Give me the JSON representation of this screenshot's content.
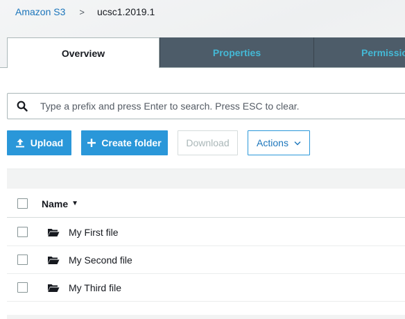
{
  "breadcrumb": {
    "root": "Amazon S3",
    "separator": ">",
    "current": "ucsc1.2019.1"
  },
  "tabs": [
    {
      "label": "Overview",
      "active": true
    },
    {
      "label": "Properties",
      "active": false
    },
    {
      "label": "Permissio",
      "active": false
    }
  ],
  "search": {
    "placeholder": "Type a prefix and press Enter to search. Press ESC to clear.",
    "value": ""
  },
  "actions": {
    "upload": "Upload",
    "create_folder": "Create folder",
    "download": "Download",
    "actions": "Actions"
  },
  "table": {
    "name_header": "Name",
    "rows": [
      {
        "name": "My First file",
        "icon": "folder-icon"
      },
      {
        "name": "My Second file",
        "icon": "folder-icon"
      },
      {
        "name": "My Third file",
        "icon": "folder-icon"
      }
    ]
  },
  "colors": {
    "primary": "#2a97d9",
    "link": "#1b75bb",
    "tab_inactive_bg": "#4d5c69",
    "tab_inactive_text": "#44b9d6"
  }
}
